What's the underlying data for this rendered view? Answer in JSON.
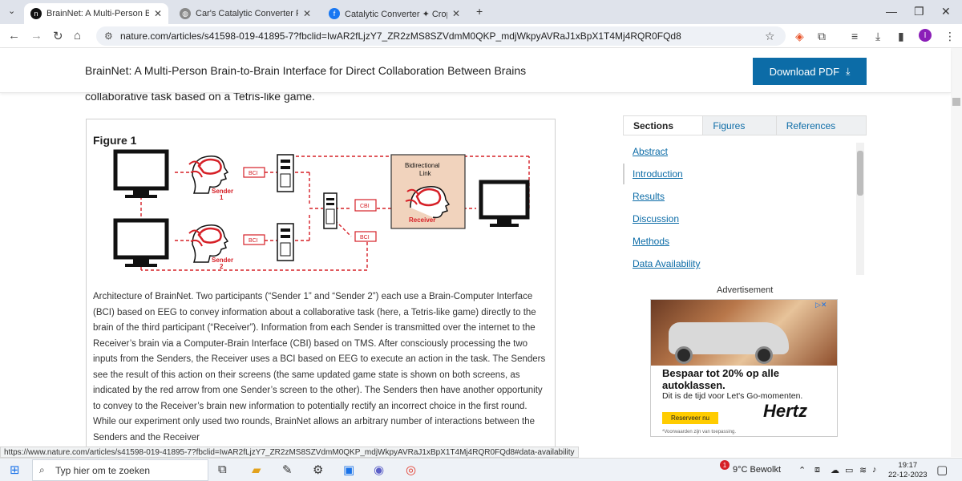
{
  "browser": {
    "tabs": [
      {
        "label": "BrainNet: A Multi-Person Brain-",
        "icon": "nature-icon",
        "active": true
      },
      {
        "label": "Car's Catalytic Converter Produ",
        "icon": "globe-icon",
        "active": false
      },
      {
        "label": "Catalytic Converter ✦ Crop Prot",
        "icon": "facebook-icon",
        "active": false
      }
    ],
    "url": "nature.com/articles/s41598-019-41895-7?fbclid=IwAR2fLjzY7_ZR2zMS8SZVdmM0QKP_mdjWkpyAVRaJ1xBpX1T4Mj4RQR0FQd8",
    "profile_initial": "I"
  },
  "header": {
    "title": "BrainNet: A Multi-Person Brain-to-Brain Interface for Direct Collaboration Between Brains",
    "download_label": "Download PDF"
  },
  "article": {
    "clipped_line": "collaborative task based on a Tetris-like game."
  },
  "figure": {
    "title": "Figure 1",
    "labels": {
      "bci": "BCI",
      "cbi": "CBI",
      "sender1": "Sender",
      "sender1_num": "1",
      "sender2": "Sender",
      "sender2_num": "2",
      "bidirectional": "Bidirectional",
      "link": "Link",
      "receiver": "Receiver"
    },
    "caption": "Architecture of BrainNet. Two participants (“Sender 1” and “Sender 2”) each use a Brain-Computer Interface (BCI) based on EEG to convey information about a collaborative task (here, a Tetris-like game) directly to the brain of the third participant (“Receiver”). Information from each Sender is transmitted over the internet to the Receiver’s brain via a Computer-Brain Interface (CBI) based on TMS. After consciously processing the two inputs from the Senders, the Receiver uses a BCI based on EEG to execute an action in the task. The Senders see the result of this action on their screens (the same updated game state is shown on both screens, as indicated by the red arrow from one Sender’s screen to the other). The Senders then have another opportunity to convey to the Receiver’s brain new information to potentially rectify an incorrect choice in the first round. While our experiment only used two rounds, BrainNet allows an arbitrary number of interactions between the Senders and the Receiver"
  },
  "sidebar": {
    "tabs": [
      "Sections",
      "Figures",
      "References"
    ],
    "sections": [
      "Abstract",
      "Introduction",
      "Results",
      "Discussion",
      "Methods",
      "Data Availability"
    ]
  },
  "ad": {
    "label": "Advertisement",
    "headline": "Bespaar tot 20% op alle autoklassen.",
    "sub": "Dit is de tijd voor Let's Go-momenten.",
    "cta": "Reserveer nu",
    "brand": "Hertz",
    "disclaimer": "*Voorwaarden zijn van toepassing."
  },
  "status_url": "https://www.nature.com/articles/s41598-019-41895-7?fbclid=IwAR2fLjzY7_ZR2zMS8SZVdmM0QKP_mdjWkpyAVRaJ1xBpX1T4Mj4RQR0FQd8#data-availability",
  "taskbar": {
    "search_placeholder": "Typ hier om te zoeken",
    "weather": "9°C Bewolkt",
    "time": "19:17",
    "date": "22-12-2023",
    "notification_count": "1"
  },
  "colors": {
    "accent": "#0c6ca7",
    "figure_red": "#d62027",
    "link_box": "#f1d3bd"
  }
}
